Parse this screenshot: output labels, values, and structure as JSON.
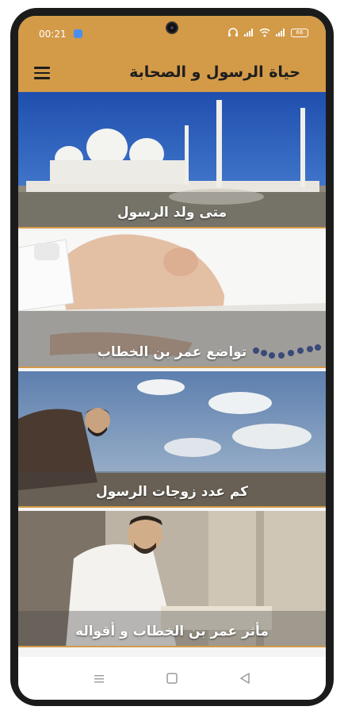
{
  "status_bar": {
    "time": "00:21",
    "battery": "66",
    "icons": [
      "headphones-icon",
      "signal-icon",
      "wifi-icon",
      "signal-icon",
      "battery-icon"
    ]
  },
  "app_bar": {
    "title": "حياة الرسول و الصحابة",
    "menu_icon": "hamburger-menu-icon"
  },
  "cards": [
    {
      "title": "متى ولد الرسول",
      "image": "mosque-domes-minarets"
    },
    {
      "title": "تواضع عمر بن الخطاب",
      "image": "man-prostrating-with-prayer-beads"
    },
    {
      "title": "كم عدد زوجات الرسول",
      "image": "man-praying-under-sky"
    },
    {
      "title": "مأثر عمر بن الخطاب و أقواله",
      "image": "man-reading-in-mosque"
    }
  ],
  "nav_bar": {
    "icons": [
      "recents-icon",
      "home-icon",
      "back-icon"
    ]
  },
  "colors": {
    "accent": "#d39a48",
    "title_text": "#1d1d1d",
    "caption_text": "#ffffff"
  }
}
